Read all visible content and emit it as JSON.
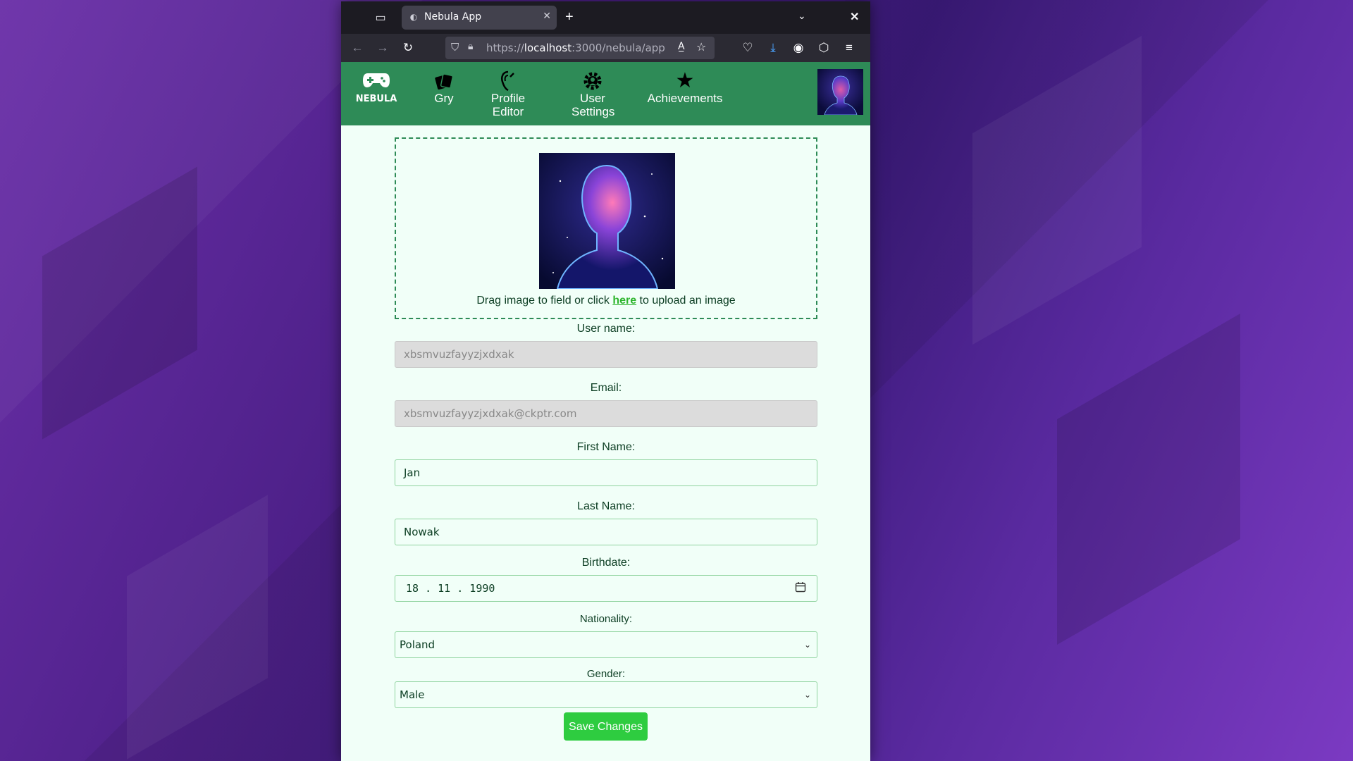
{
  "browser": {
    "tab_title": "Nebula App",
    "url_prefix": "https://",
    "url_host": "localhost",
    "url_path": ":3000/nebula/app"
  },
  "app": {
    "logo_text": "NEBULA",
    "nav": [
      {
        "label": "Gry",
        "icon": "cards-icon"
      },
      {
        "label": "Profile Editor",
        "icon": "profile-editor-icon"
      },
      {
        "label": "User Settings",
        "icon": "settings-gear-icon"
      },
      {
        "label": "Achievements",
        "icon": "star-icon"
      }
    ]
  },
  "upload": {
    "hint_before": "Drag image to field or click ",
    "hint_link": "here",
    "hint_after": " to upload an image"
  },
  "form": {
    "username_label": "User name:",
    "username_value": "xbsmvuzfayyzjxdxak",
    "email_label": "Email:",
    "email_value": "xbsmvuzfayyzjxdxak@ckptr.com",
    "firstname_label": "First Name:",
    "firstname_value": "Jan",
    "lastname_label": "Last Name:",
    "lastname_value": "Nowak",
    "birthdate_label": "Birthdate:",
    "birthdate_value": "18 . 11 . 1990",
    "nationality_label": "Nationality:",
    "nationality_value": "Poland",
    "gender_label": "Gender:",
    "gender_value": "Male",
    "save_label": "Save Changes"
  },
  "colors": {
    "header": "#2e8b57",
    "save_button": "#2ecc40",
    "link": "#2db52d"
  }
}
